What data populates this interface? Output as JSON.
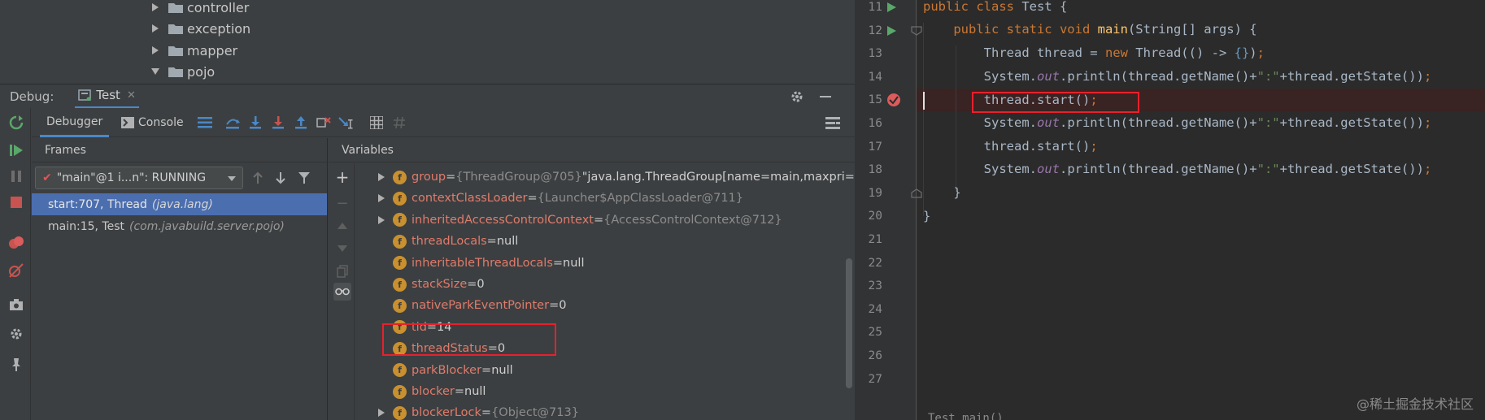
{
  "project_tree": {
    "items": [
      {
        "label": "controller",
        "expanded": false
      },
      {
        "label": "exception",
        "expanded": false
      },
      {
        "label": "mapper",
        "expanded": false
      },
      {
        "label": "pojo",
        "expanded": true
      }
    ]
  },
  "debug": {
    "title": "Debug:",
    "tab_label": "Test",
    "subtabs": {
      "debugger": "Debugger",
      "console": "Console"
    },
    "frames_title": "Frames",
    "variables_title": "Variables",
    "thread_select": "\"main\"@1 i...n\": RUNNING",
    "frames": [
      {
        "method": "start:707, Thread",
        "pkg": "(java.lang)",
        "selected": true
      },
      {
        "method": "main:15, Test",
        "pkg": "(com.javabuild.server.pojo)",
        "selected": false
      }
    ],
    "variables": [
      {
        "name": "group",
        "eq": " = ",
        "ref": "{ThreadGroup@705} ",
        "value": "\"java.lang.ThreadGroup[name=main,maxpri=",
        "expandable": true
      },
      {
        "name": "contextClassLoader",
        "eq": " = ",
        "ref": "{Launcher$AppClassLoader@711}",
        "value": "",
        "expandable": true
      },
      {
        "name": "inheritedAccessControlContext",
        "eq": " = ",
        "ref": "{AccessControlContext@712}",
        "value": "",
        "expandable": true
      },
      {
        "name": "threadLocals",
        "eq": " = ",
        "ref": "",
        "value": "null",
        "expandable": false
      },
      {
        "name": "inheritableThreadLocals",
        "eq": " = ",
        "ref": "",
        "value": "null",
        "expandable": false
      },
      {
        "name": "stackSize",
        "eq": " = ",
        "ref": "",
        "value": "0",
        "expandable": false
      },
      {
        "name": "nativeParkEventPointer",
        "eq": " = ",
        "ref": "",
        "value": "0",
        "expandable": false
      },
      {
        "name": "tid",
        "eq": " = ",
        "ref": "",
        "value": "14",
        "expandable": false
      },
      {
        "name": "threadStatus",
        "eq": " = ",
        "ref": "",
        "value": "0",
        "expandable": false
      },
      {
        "name": "parkBlocker",
        "eq": " = ",
        "ref": "",
        "value": "null",
        "expandable": false
      },
      {
        "name": "blocker",
        "eq": " = ",
        "ref": "",
        "value": "null",
        "expandable": false
      },
      {
        "name": "blockerLock",
        "eq": " = ",
        "ref": "{Object@713}",
        "value": "",
        "expandable": true
      }
    ]
  },
  "editor": {
    "line_numbers": [
      "11",
      "12",
      "13",
      "14",
      "15",
      "16",
      "17",
      "18",
      "19",
      "20",
      "21",
      "22",
      "23",
      "24",
      "25",
      "26",
      "27"
    ],
    "breakpoint_line": "15",
    "watermark": "@稀土掘金技术社区",
    "bottom_clip": "Test  main()"
  },
  "colors": {
    "selection": "#4b6eaf",
    "highlight_box": "#e8202c",
    "keyword": "#cc7832",
    "function": "#ffc66d"
  }
}
